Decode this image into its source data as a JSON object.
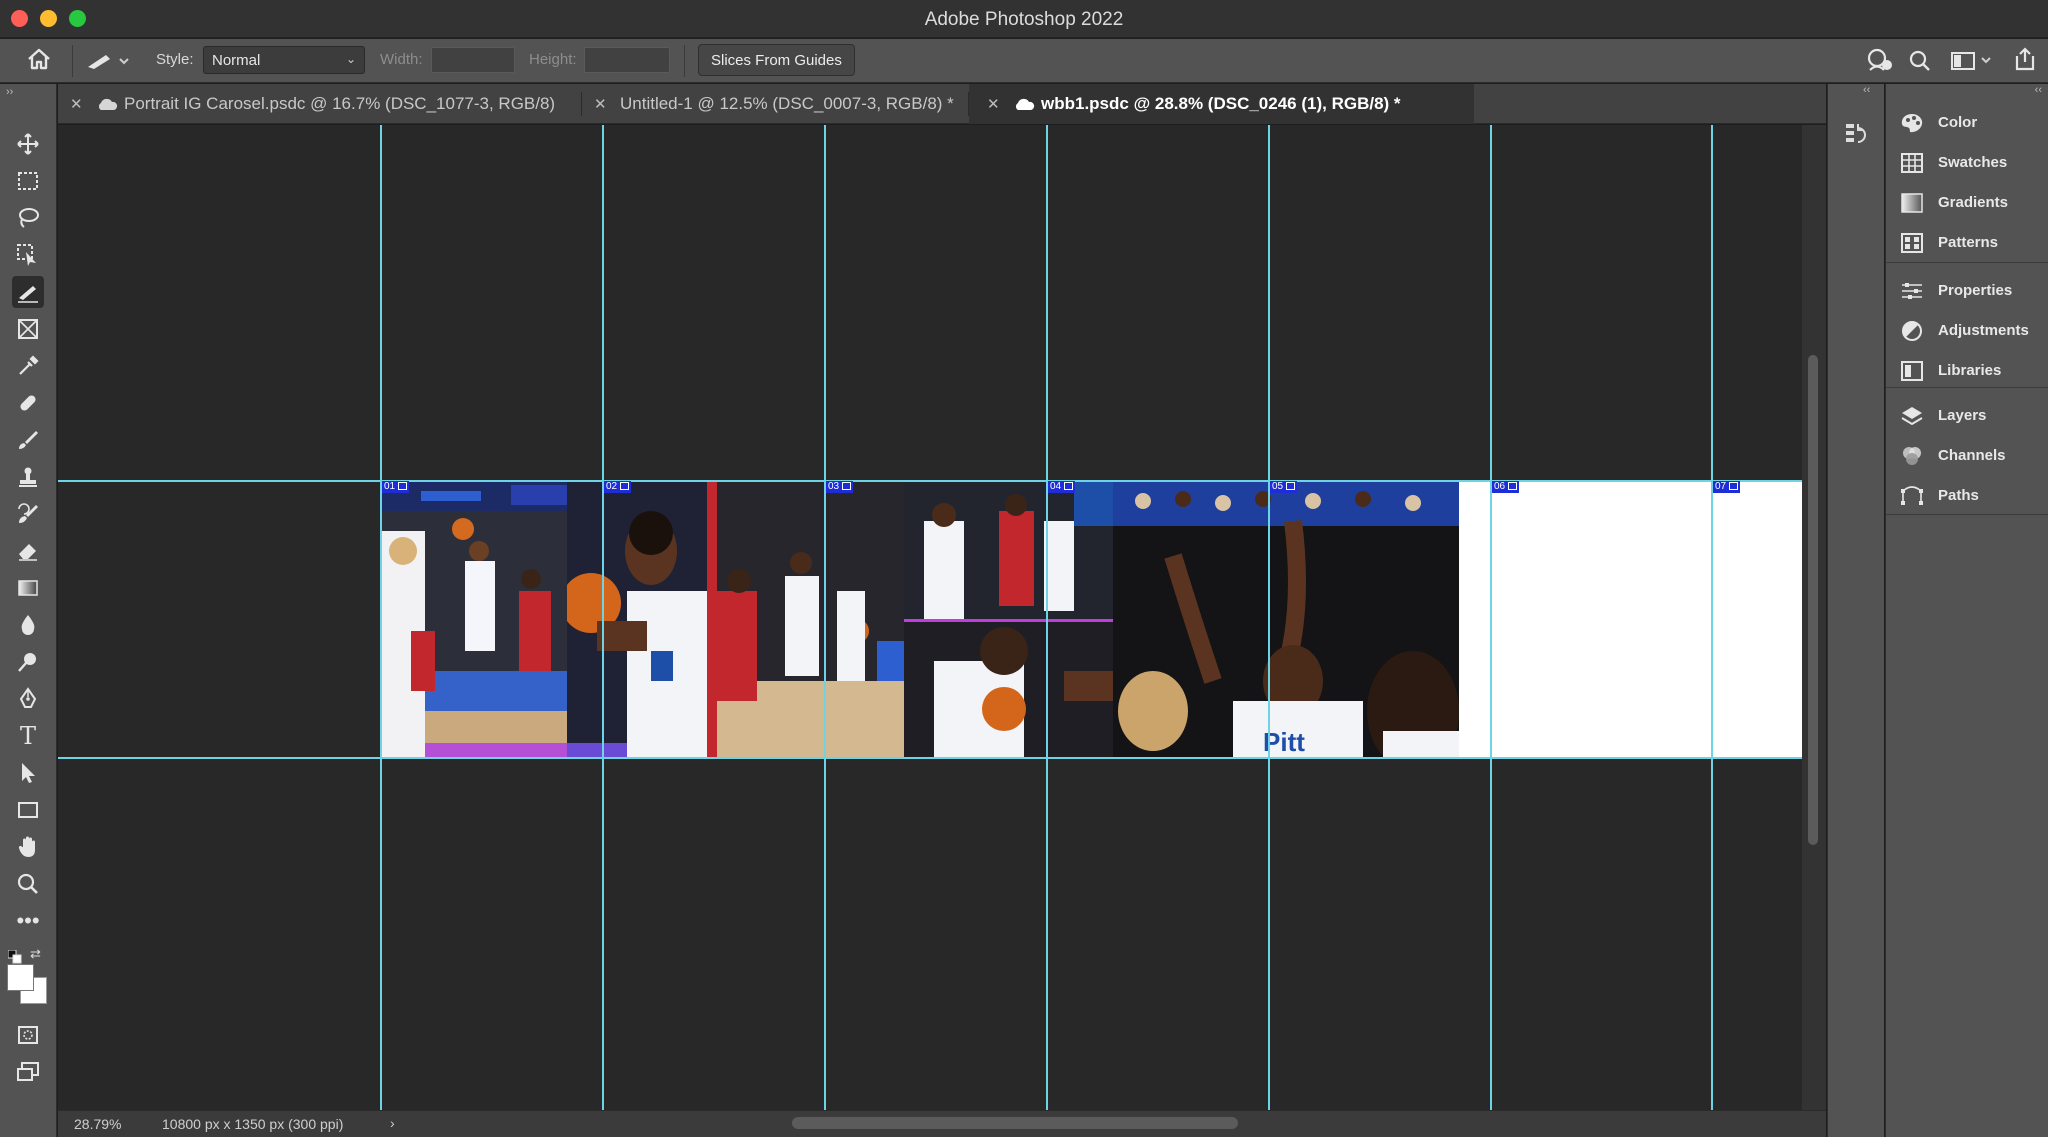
{
  "app": {
    "title": "Adobe Photoshop 2022"
  },
  "options_bar": {
    "style_label": "Style:",
    "style_value": "Normal",
    "width_label": "Width:",
    "height_label": "Height:",
    "slices_button": "Slices From Guides"
  },
  "tabs": [
    {
      "label": "Portrait IG Carosel.psdc @ 16.7% (DSC_1077-3, RGB/8)",
      "cloud": true,
      "active": false
    },
    {
      "label": "Untitled-1 @ 12.5% (DSC_0007-3, RGB/8) *",
      "cloud": false,
      "active": false
    },
    {
      "label": "wbb1.psdc @ 28.8% (DSC_0246 (1), RGB/8) *",
      "cloud": true,
      "active": true
    }
  ],
  "slices": [
    "01",
    "02",
    "03",
    "04",
    "05",
    "06",
    "07"
  ],
  "status": {
    "zoom": "28.79%",
    "doc_info": "10800 px x 1350 px (300 ppi)",
    "arrow": "›"
  },
  "panels": {
    "group1": [
      "Color",
      "Swatches",
      "Gradients",
      "Patterns"
    ],
    "group2": [
      "Properties",
      "Adjustments",
      "Libraries"
    ],
    "group3": [
      "Layers",
      "Channels",
      "Paths"
    ]
  },
  "tools": [
    "move-tool",
    "marquee-tool",
    "lasso-tool",
    "object-selection-tool",
    "slice-tool",
    "frame-tool",
    "eyedropper-tool",
    "healing-brush-tool",
    "brush-tool",
    "clone-stamp-tool",
    "history-brush-tool",
    "eraser-tool",
    "gradient-tool",
    "blur-tool",
    "dodge-tool",
    "pen-tool",
    "type-tool",
    "path-selection-tool",
    "rectangle-tool",
    "hand-tool",
    "zoom-tool",
    "edit-toolbar"
  ],
  "colors": {
    "guide": "#6fd3e6",
    "slice_label_bg": "#1f2dd6",
    "pitt_blue": "#1d4fa8",
    "nc_red": "#c1272d"
  }
}
